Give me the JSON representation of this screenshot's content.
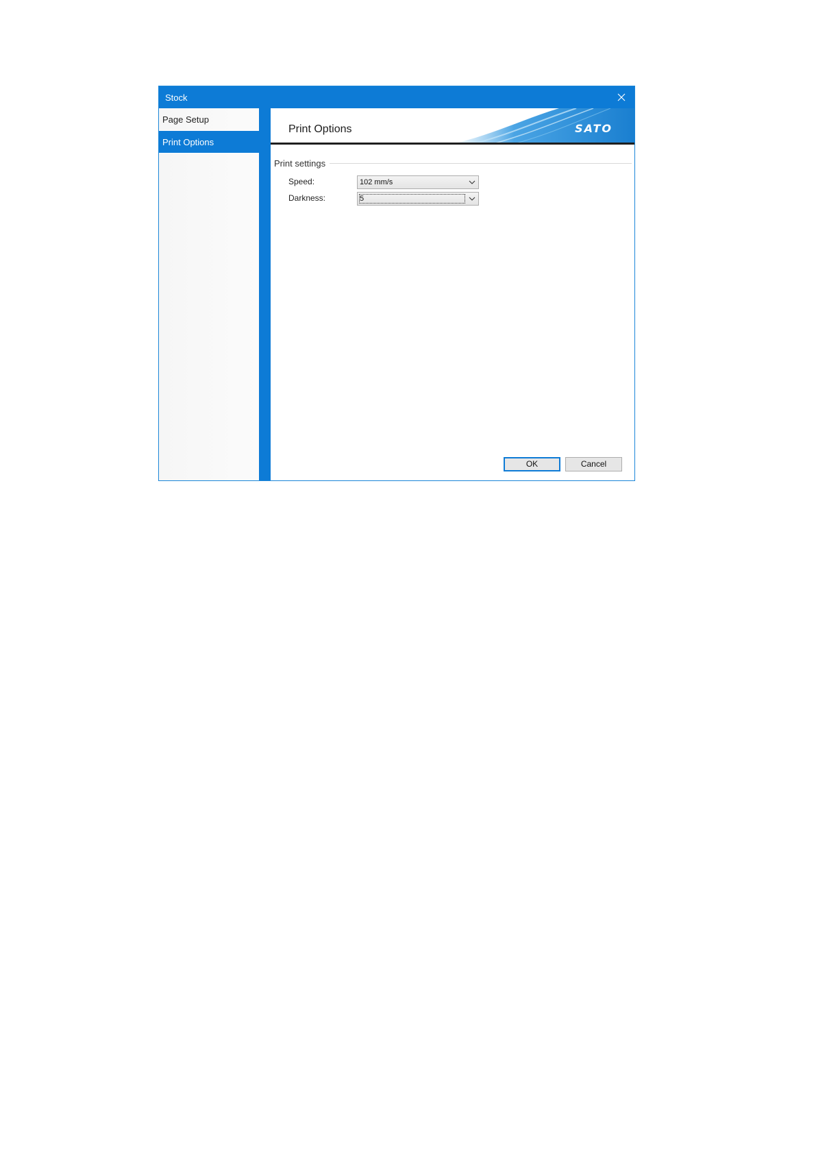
{
  "window": {
    "title": "Stock",
    "close_icon": "close-icon"
  },
  "nav": {
    "items": [
      {
        "label": "Page Setup",
        "active": false
      },
      {
        "label": "Print Options",
        "active": true
      }
    ]
  },
  "banner": {
    "heading": "Print Options",
    "logo": "SATO"
  },
  "print_settings": {
    "group_label": "Print settings",
    "speed": {
      "label": "Speed:",
      "value": "102 mm/s"
    },
    "darkness": {
      "label": "Darkness:",
      "value": "5"
    }
  },
  "buttons": {
    "ok_label": "OK",
    "cancel_label": "Cancel"
  },
  "colors": {
    "accent": "#0d7bd6"
  }
}
